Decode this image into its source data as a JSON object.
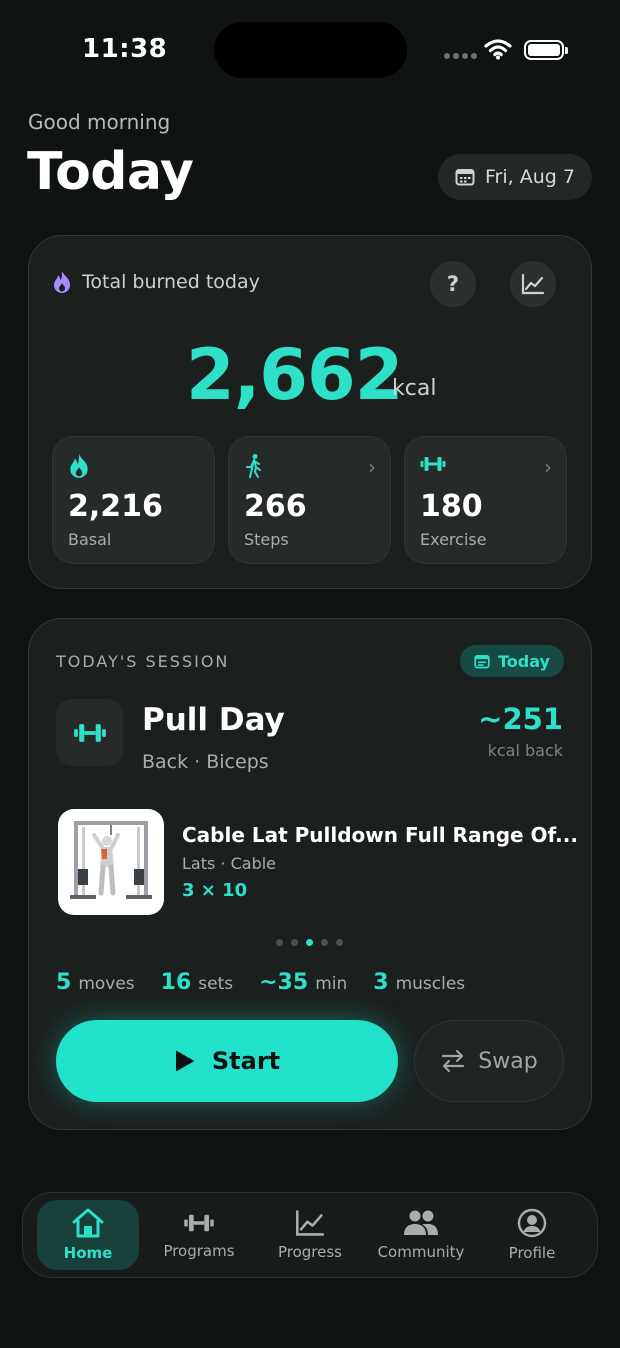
{
  "status": {
    "time": "11:38"
  },
  "header": {
    "greeting": "Good morning",
    "title": "Today",
    "date": "Fri, Aug 7"
  },
  "burn": {
    "label": "Total burned today",
    "total": "2,662",
    "unit": "kcal",
    "tiles": [
      {
        "value": "2,216",
        "label": "Basal",
        "icon": "flame-icon"
      },
      {
        "value": "266",
        "label": "Steps",
        "icon": "walking-icon"
      },
      {
        "value": "180",
        "label": "Exercise",
        "icon": "dumbbell-icon"
      }
    ]
  },
  "session": {
    "heading": "TODAY'S SESSION",
    "badge": "Today",
    "name": "Pull Day",
    "muscles": "Back · Biceps",
    "kcal": "~251",
    "kcal_label": "kcal back",
    "exercise": {
      "name": "Cable Lat Pulldown Full Range Of...",
      "meta": "Lats · Cable",
      "sets": "3 × 10"
    },
    "carousel": {
      "count": 5,
      "active_index": 2
    },
    "stats": [
      {
        "value": "5",
        "label": "moves"
      },
      {
        "value": "16",
        "label": "sets"
      },
      {
        "value": "~35",
        "label": "min"
      },
      {
        "value": "3",
        "label": "muscles"
      }
    ],
    "start_label": "Start",
    "swap_label": "Swap"
  },
  "nav": {
    "items": [
      {
        "label": "Home",
        "icon": "home-icon"
      },
      {
        "label": "Programs",
        "icon": "dumbbell-icon"
      },
      {
        "label": "Progress",
        "icon": "chart-icon"
      },
      {
        "label": "Community",
        "icon": "people-icon"
      },
      {
        "label": "Profile",
        "icon": "profile-icon"
      }
    ],
    "active": "Home"
  },
  "colors": {
    "accent": "#2ee0c8",
    "background": "#0f1413",
    "card": "#1b1f1e"
  }
}
